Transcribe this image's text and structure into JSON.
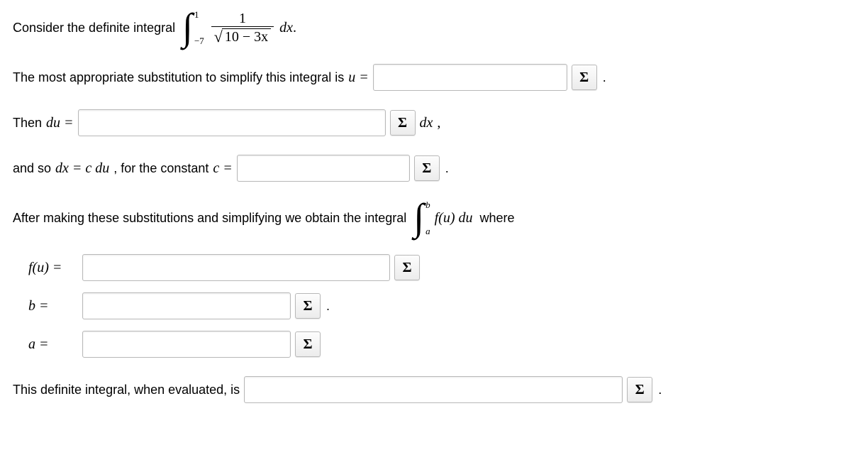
{
  "sigma_label": "Σ",
  "line1": {
    "prefix": "Consider the definite integral",
    "int_lower": "−7",
    "int_upper": "1",
    "frac_num": "1",
    "frac_den_inside": "10 − 3x",
    "dx": "dx",
    "period": "."
  },
  "line2": {
    "text": "The most appropriate substitution to simplify this integral is",
    "var": "u =",
    "period": "."
  },
  "line3": {
    "prefix": "Then",
    "var": "du =",
    "suffix": "dx",
    "comma": ","
  },
  "line4": {
    "prefix": "and so",
    "eq1": "dx = c du",
    "mid": ", for the constant",
    "eq2": "c =",
    "period": "."
  },
  "line5": {
    "text": "After making these substitutions and simplifying we obtain the integral",
    "int_lower": "a",
    "int_upper": "b",
    "integrand": "f(u) du",
    "suffix": "where"
  },
  "answers": {
    "fu_label": "f(u) =",
    "b_label": "b =",
    "a_label": "a =",
    "period": "."
  },
  "line6": {
    "text": "This definite integral, when evaluated, is",
    "period": "."
  },
  "inputs": {
    "u": "",
    "du": "",
    "c": "",
    "fu": "",
    "b": "",
    "a": "",
    "final": ""
  }
}
